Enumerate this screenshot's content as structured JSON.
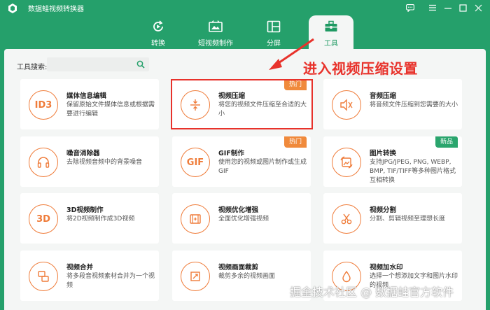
{
  "app": {
    "title": "数据蛙视频转换器"
  },
  "tabs": [
    {
      "label": "转换",
      "icon": "convert-icon",
      "active": false
    },
    {
      "label": "短视频制作",
      "icon": "video-maker-icon",
      "active": false
    },
    {
      "label": "分屏",
      "icon": "split-screen-icon",
      "active": false
    },
    {
      "label": "工具",
      "icon": "toolbox-icon",
      "active": true
    }
  ],
  "search": {
    "label": "工具搜索:",
    "value": ""
  },
  "annotation": {
    "text": "进入视频压缩设置"
  },
  "tools": [
    {
      "title": "媒体信息编辑",
      "desc": "保留原始文件媒体信息或根据需要进行编辑",
      "icon": "id3-icon",
      "badge": ""
    },
    {
      "title": "视频压缩",
      "desc": "将您的视频文件压缩至合适的大小",
      "icon": "compress-icon",
      "badge": "热门"
    },
    {
      "title": "音频压缩",
      "desc": "将音频文件压缩到您需要的大小",
      "icon": "audio-compress-icon",
      "badge": ""
    },
    {
      "title": "噪音消除器",
      "desc": "去除视频音频中的背景噪音",
      "icon": "headphones-icon",
      "badge": ""
    },
    {
      "title": "GIF制作",
      "desc": "使用您的视频或图片制作或生成GIF",
      "icon": "gif-icon",
      "badge": "热门"
    },
    {
      "title": "图片转换",
      "desc": "支持JPG/JPEG, PNG, WEBP, BMP, TIF/TIFF等多种图片格式互相转换",
      "icon": "image-convert-icon",
      "badge": "新品"
    },
    {
      "title": "3D视频制作",
      "desc": "将2D视频制作成3D视频",
      "icon": "3d-icon",
      "badge": ""
    },
    {
      "title": "视频优化增强",
      "desc": "全面优化增强视频",
      "icon": "enhance-icon",
      "badge": ""
    },
    {
      "title": "视频分割",
      "desc": "分割、剪辑视频至理想长度",
      "icon": "scissors-icon",
      "badge": ""
    },
    {
      "title": "视频合并",
      "desc": "将多段音视频素材合并为一个视频",
      "icon": "merge-icon",
      "badge": ""
    },
    {
      "title": "视频画面裁剪",
      "desc": "裁剪多余的视频画面",
      "icon": "crop-icon",
      "badge": ""
    },
    {
      "title": "视频加水印",
      "desc": "选择一个想添加文字和图片水印的视频",
      "icon": "watermark-icon",
      "badge": ""
    }
  ],
  "watermark": {
    "text": "掘金技术社区 @ 数据蛙官方软件"
  },
  "colors": {
    "brand": "#25a06b",
    "accent": "#ef7c3a",
    "annotation": "#e8322b",
    "new_badge": "#2aa56d"
  }
}
